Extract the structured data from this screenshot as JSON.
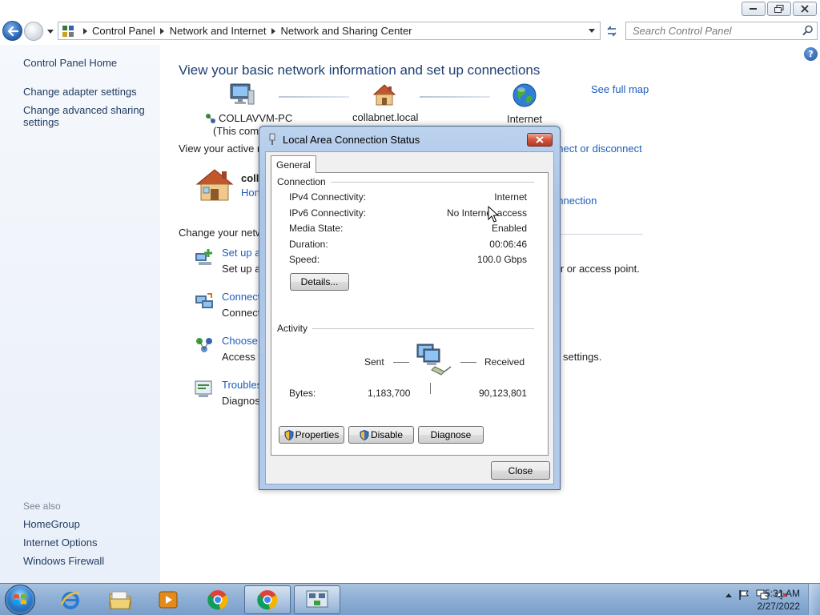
{
  "address_bar": {
    "breadcrumbs": [
      "Control Panel",
      "Network and Internet",
      "Network and Sharing Center"
    ],
    "search_placeholder": "Search Control Panel"
  },
  "left_nav": {
    "home": "Control Panel Home",
    "links": [
      "Change adapter settings",
      "Change advanced sharing settings"
    ],
    "see_also_heading": "See also",
    "see_also": [
      "HomeGroup",
      "Internet Options",
      "Windows Firewall"
    ]
  },
  "main": {
    "title": "View your basic network information and set up connections",
    "see_full_map": "See full map",
    "map": {
      "pc_name": "COLLAVVM-PC",
      "pc_sub": "(This comp",
      "domain": "collabnet.local",
      "internet": "Internet"
    },
    "active_networks_label": "View your active ne",
    "connect_disconnect": "nnect or disconnect",
    "active_network_name": "colla",
    "active_network_type": "Hon",
    "active_connection": "onnection",
    "change_settings_label": "Change your netwo",
    "tasks": [
      {
        "link": "Set up a",
        "desc": "Set up a"
      },
      {
        "link": "Connect",
        "desc": "Connect"
      },
      {
        "link": "Choose h",
        "desc": "Access fi"
      },
      {
        "link": "Troubles",
        "desc": "Diagnose"
      }
    ],
    "right_fragments": [
      "ter or access point.",
      "settings."
    ]
  },
  "dialog": {
    "title": "Local Area Connection Status",
    "tab": "General",
    "connection_heading": "Connection",
    "connection_rows": [
      {
        "label": "IPv4 Connectivity:",
        "value": "Internet"
      },
      {
        "label": "IPv6 Connectivity:",
        "value": "No Internet access"
      },
      {
        "label": "Media State:",
        "value": "Enabled"
      },
      {
        "label": "Duration:",
        "value": "00:06:46"
      },
      {
        "label": "Speed:",
        "value": "100.0 Gbps"
      }
    ],
    "details_button": "Details...",
    "activity_heading": "Activity",
    "sent_label": "Sent",
    "received_label": "Received",
    "bytes_label": "Bytes:",
    "bytes_sent": "1,183,700",
    "bytes_received": "90,123,801",
    "properties_button": "Properties",
    "disable_button": "Disable",
    "diagnose_button": "Diagnose",
    "close_button": "Close"
  },
  "taskbar": {
    "items": [
      "internet-explorer",
      "windows-explorer",
      "windows-media-player",
      "chrome",
      "chrome",
      "network-and-sharing-center"
    ],
    "clock_time": "5:31 AM",
    "clock_date": "2/27/2022"
  }
}
